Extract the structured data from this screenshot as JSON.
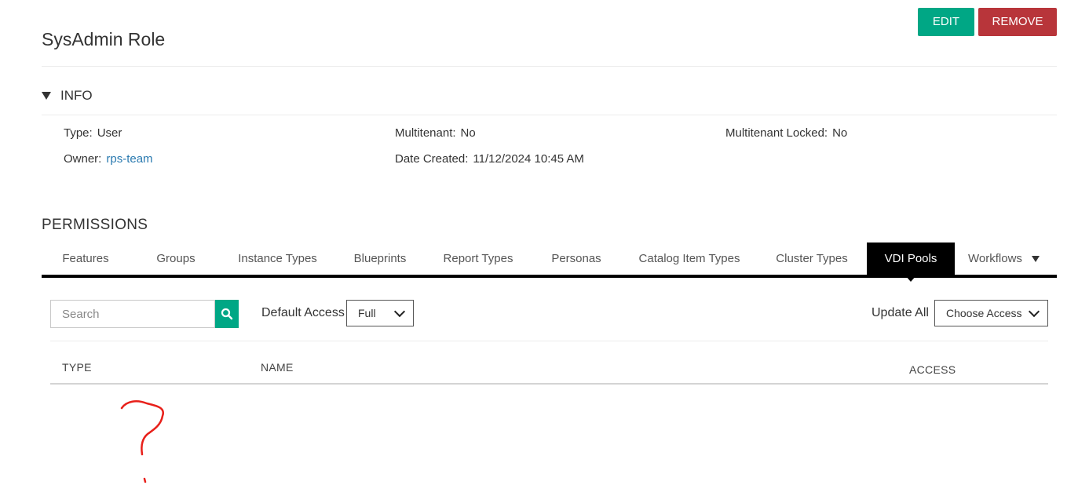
{
  "header": {
    "title": "SysAdmin Role",
    "edit_label": "EDIT",
    "remove_label": "REMOVE"
  },
  "info": {
    "section_label": "INFO",
    "type_label": "Type:",
    "type_value": "User",
    "owner_label": "Owner:",
    "owner_value": "rps-team",
    "multitenant_label": "Multitenant:",
    "multitenant_value": "No",
    "date_created_label": "Date Created:",
    "date_created_value": "11/12/2024 10:45 AM",
    "multitenant_locked_label": "Multitenant Locked:",
    "multitenant_locked_value": "No"
  },
  "permissions": {
    "title": "PERMISSIONS",
    "tabs": [
      {
        "label": "Features"
      },
      {
        "label": "Groups"
      },
      {
        "label": "Instance Types"
      },
      {
        "label": "Blueprints"
      },
      {
        "label": "Report Types"
      },
      {
        "label": "Personas"
      },
      {
        "label": "Catalog Item Types"
      },
      {
        "label": "Cluster Types"
      },
      {
        "label": "VDI Pools"
      },
      {
        "label": "Workflows"
      }
    ],
    "active_tab": "VDI Pools",
    "search_placeholder": "Search",
    "default_access_label": "Default Access",
    "default_access_value": "Full",
    "update_all_label": "Update All",
    "update_all_value": "Choose Access",
    "columns": {
      "type": "TYPE",
      "name": "NAME",
      "access": "ACCESS"
    }
  },
  "colors": {
    "edit_button": "#00a785",
    "remove_button": "#b8353a",
    "link": "#2a7ab0",
    "active_tab": "#000000",
    "annotation": "#e8201a"
  },
  "annotation": {
    "mark": "question-mark"
  }
}
